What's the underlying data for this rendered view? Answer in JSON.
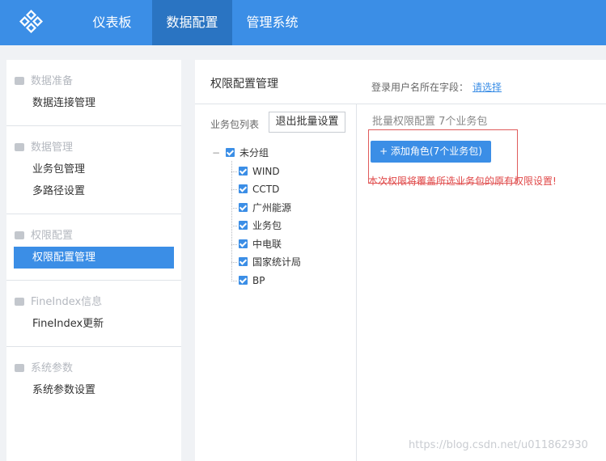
{
  "topbar": {
    "logo_icon": "diamond-logo-icon",
    "tabs": [
      {
        "label": "仪表板",
        "active": false
      },
      {
        "label": "数据配置",
        "active": true
      },
      {
        "label": "管理系统",
        "active": false
      }
    ],
    "bg_color": "#3b8ee6",
    "active_color": "#2a74c2"
  },
  "sidebar": {
    "groups": [
      {
        "title": "数据准备",
        "items": [
          {
            "label": "数据连接管理",
            "active": false
          }
        ]
      },
      {
        "title": "数据管理",
        "items": [
          {
            "label": "业务包管理",
            "active": false
          },
          {
            "label": "多路径设置",
            "active": false
          }
        ]
      },
      {
        "title": "权限配置",
        "items": [
          {
            "label": "权限配置管理",
            "active": true
          }
        ]
      },
      {
        "title": "FineIndex信息",
        "items": [
          {
            "label": "FineIndex更新",
            "active": false
          }
        ]
      },
      {
        "title": "系统参数",
        "items": [
          {
            "label": "系统参数设置",
            "active": false
          }
        ]
      }
    ]
  },
  "main": {
    "title": "权限配置管理",
    "login_field_label": "登录用户名所在字段：",
    "choose_link": "请选择",
    "package_list_label": "业务包列表",
    "exit_batch_button": "退出批量设置",
    "tree": {
      "root": {
        "label": "未分组",
        "checked": true,
        "expanded": true
      },
      "children": [
        {
          "label": "WIND",
          "checked": true
        },
        {
          "label": "CCTD",
          "checked": true
        },
        {
          "label": "广州能源",
          "checked": true
        },
        {
          "label": "业务包",
          "checked": true
        },
        {
          "label": "中电联",
          "checked": true
        },
        {
          "label": "国家统计局",
          "checked": true
        },
        {
          "label": "BP",
          "checked": true
        }
      ],
      "collapse_symbol": "−"
    },
    "batch_title": "批量权限配置 7个业务包",
    "add_role_button": "+ 添加角色(7个业务包)",
    "warning": "本次权限将覆盖所选业务包的原有权限设置!"
  },
  "watermark": "https://blog.csdn.net/u011862930"
}
